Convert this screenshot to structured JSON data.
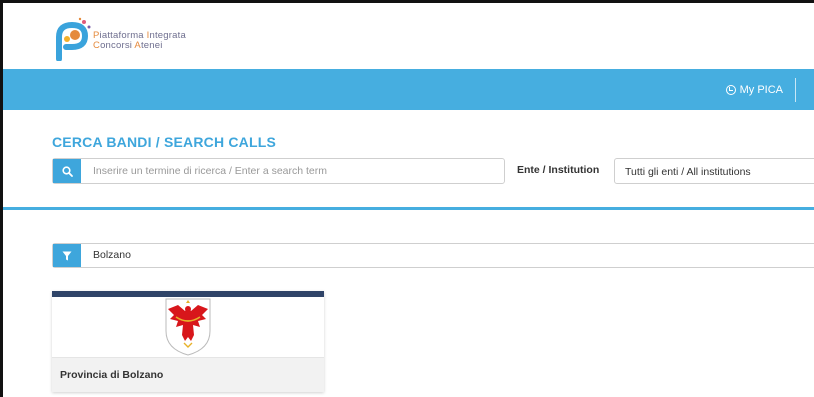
{
  "header": {
    "logo_line1_hl": "P",
    "logo_line1_rest": "iattaforma ",
    "logo_line1_hl2": "I",
    "logo_line1_rest2": "ntegrata",
    "logo_line2_hl": "C",
    "logo_line2_rest": "oncorsi ",
    "logo_line2_hl2": "A",
    "logo_line2_rest2": "tenei"
  },
  "nav": {
    "mypica_label": "My PICA"
  },
  "search": {
    "title": "CERCA BANDI / SEARCH CALLS",
    "placeholder": "Inserire un termine di ricerca / Enter a search term",
    "ente_label": "Ente / Institution",
    "ente_selected": "Tutti gli enti / All institutions"
  },
  "filter": {
    "value": "Bolzano"
  },
  "cards": [
    {
      "title": "Provincia di Bolzano"
    }
  ],
  "colors": {
    "accent": "#46aee0",
    "card_bar": "#2f4468",
    "logo_orange": "#e58a3c"
  },
  "icons": {
    "search": "search-icon",
    "filter": "filter-icon",
    "user": "user-circle-icon"
  }
}
